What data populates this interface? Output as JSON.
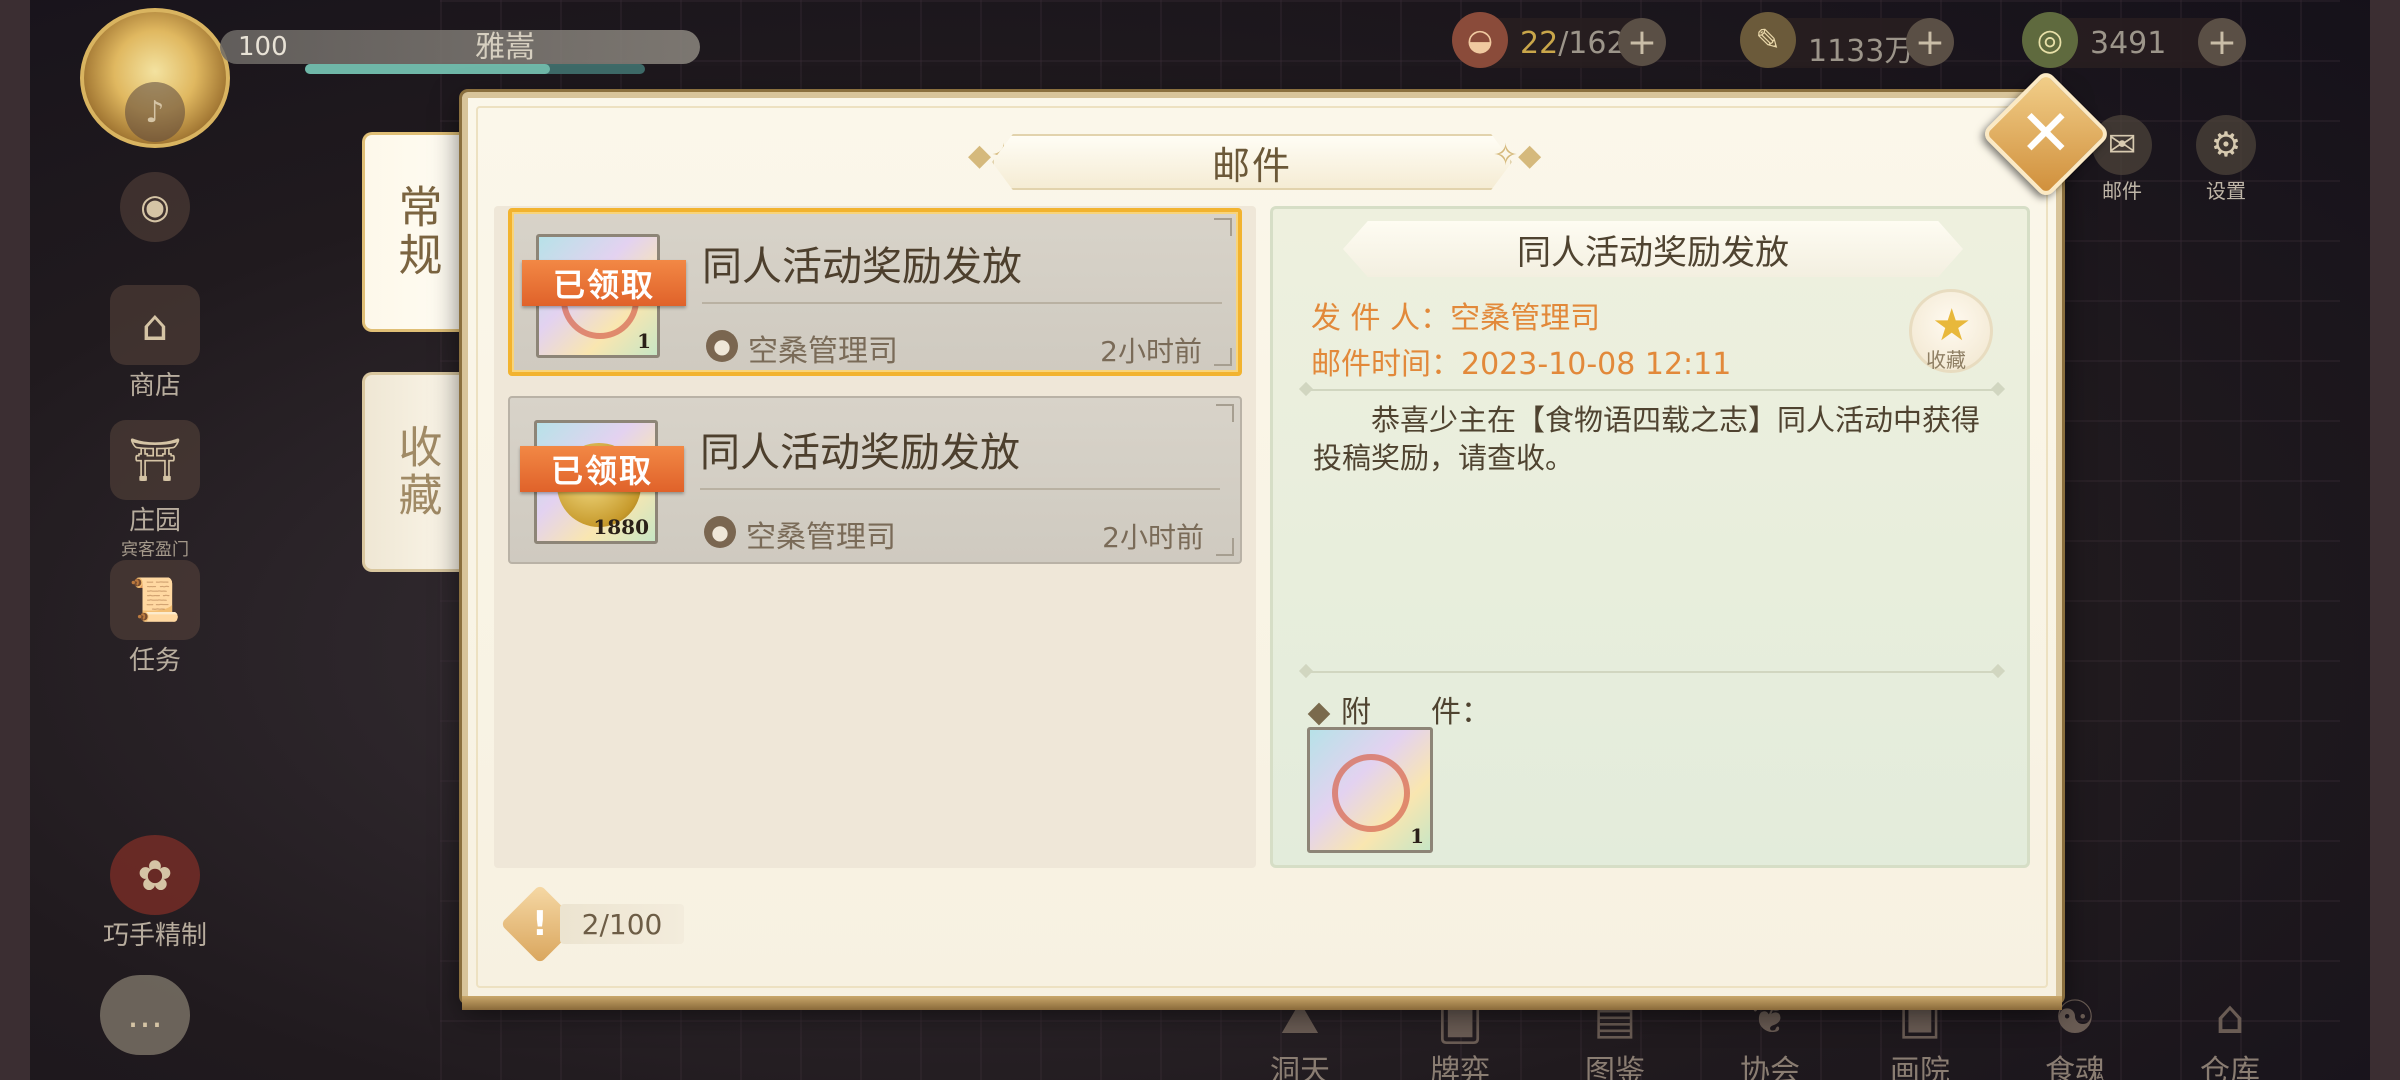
{
  "hud": {
    "level": "100",
    "player_name": "雅嵩",
    "exp_fraction": 0.72,
    "resources": [
      {
        "icon": "food-bowl-icon",
        "value_current": "22",
        "value_sep": "/162"
      },
      {
        "icon": "feather-icon",
        "value": "1133万"
      },
      {
        "icon": "jade-coin-icon",
        "value": "3491"
      }
    ],
    "top_buttons": [
      {
        "label": "邮件",
        "icon": "mail-icon"
      },
      {
        "label": "设置",
        "icon": "gear-icon"
      }
    ]
  },
  "side_menu": [
    {
      "label": "商店",
      "icon": "shop-icon"
    },
    {
      "label": "庄园",
      "sub": "宾客盈门",
      "icon": "manor-icon"
    },
    {
      "label": "任务",
      "icon": "scroll-icon"
    },
    {
      "label": "巧手精制",
      "icon": "craft-icon"
    }
  ],
  "bottom_nav": [
    {
      "label": "洞天",
      "icon": "cave-icon"
    },
    {
      "label": "牌弈",
      "icon": "cards-icon"
    },
    {
      "label": "图鉴",
      "icon": "book-icon"
    },
    {
      "label": "协会",
      "icon": "guild-icon"
    },
    {
      "label": "画院",
      "icon": "painting-icon"
    },
    {
      "label": "食魂",
      "icon": "soul-icon"
    },
    {
      "label": "仓库",
      "icon": "warehouse-icon"
    }
  ],
  "mail": {
    "title": "邮件",
    "tabs": [
      {
        "label": "常规",
        "active": true
      },
      {
        "label": "收藏",
        "active": false
      }
    ],
    "items": [
      {
        "title": "同人活动奖励发放",
        "sender": "空桑管理司",
        "time": "2小时前",
        "status": "已领取",
        "count": "1",
        "selected": true
      },
      {
        "title": "同人活动奖励发放",
        "sender": "空桑管理司",
        "time": "2小时前",
        "status": "已领取",
        "count": "1880",
        "selected": false
      }
    ],
    "detail": {
      "title": "同人活动奖励发放",
      "sender_line": "发 件 人：空桑管理司",
      "time_line": "邮件时间：2023-10-08  12:11",
      "favorite_label": "收藏",
      "body": "恭喜少主在【食物语四载之志】同人活动中获得投稿奖励，请查收。",
      "attachment_label": "附　　件：",
      "attachment_count": "1"
    },
    "capacity": "2/100",
    "close_label": "✕"
  },
  "colors": {
    "accent_orange": "#e2893a",
    "selected_border": "#f2b32f",
    "claimed_banner": "#f28845"
  }
}
